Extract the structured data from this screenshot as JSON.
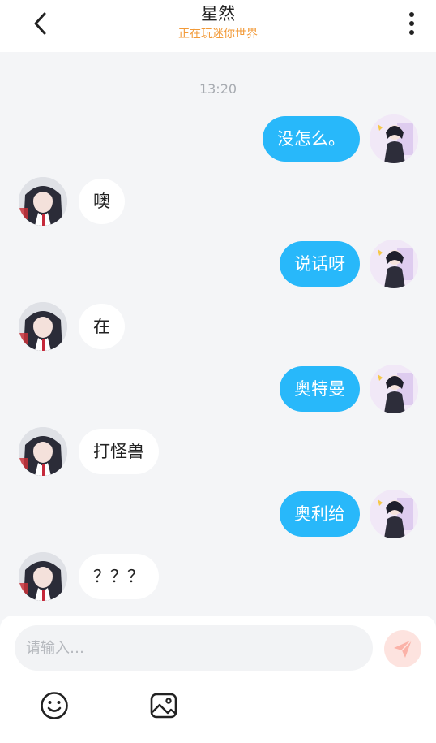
{
  "header": {
    "title": "星然",
    "status": "正在玩迷你世界",
    "back_icon": "chevron-left-icon",
    "more_icon": "vertical-ellipsis-icon"
  },
  "chat": {
    "timestamp": "13:20",
    "messages": [
      {
        "from": "me",
        "text": "没怎么。"
      },
      {
        "from": "them",
        "text": "噢"
      },
      {
        "from": "me",
        "text": "说话呀"
      },
      {
        "from": "them",
        "text": "在"
      },
      {
        "from": "me",
        "text": "奥特曼"
      },
      {
        "from": "them",
        "text": "打怪兽"
      },
      {
        "from": "me",
        "text": "奥利给"
      },
      {
        "from": "them",
        "text": "？？？"
      }
    ]
  },
  "composer": {
    "placeholder": "请输入…",
    "value": "",
    "send_icon": "paper-plane-icon",
    "emoji_icon": "smiley-icon",
    "image_icon": "image-icon"
  },
  "colors": {
    "accent": "#28b8fa",
    "status": "#f29a38",
    "background": "#f4f5f7"
  }
}
